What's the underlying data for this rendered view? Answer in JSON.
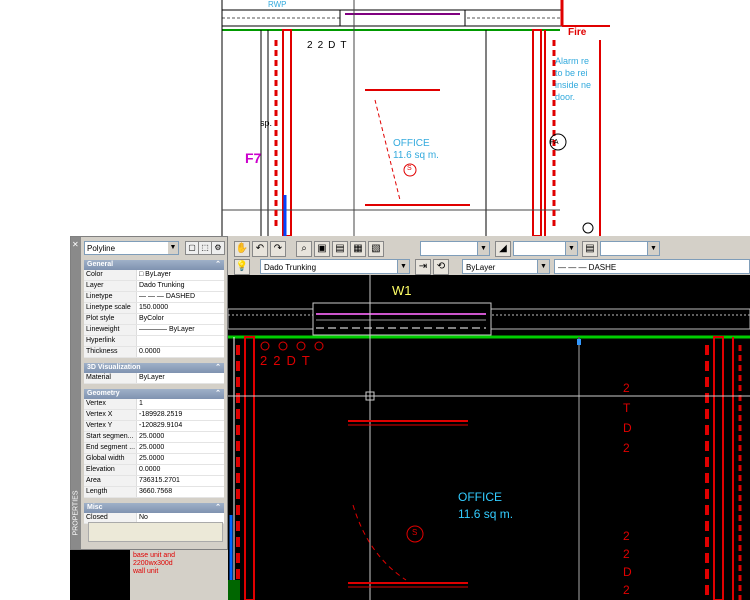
{
  "top_drawing": {
    "rwp_label": "RWP",
    "fire_label": "Fire",
    "alarm_note_lines": [
      "Alarm re",
      "to be rei",
      "inside ne",
      "door."
    ],
    "room_name": "OFFICE",
    "room_area": "11.6 sq m.",
    "socket_symbol": "S",
    "outlet_labels": [
      "2",
      "2",
      "D",
      "T"
    ],
    "grid_label": "F7",
    "fa_symbol": "FA",
    "sp_label": "sp."
  },
  "toolbar": {
    "layer_combo": "Dado Trunking",
    "color_combo": "ByLayer",
    "linetype_combo": "— — — DASHE"
  },
  "properties": {
    "selection": "Polyline",
    "side_title": "PROPERTIES",
    "sections": [
      {
        "title": "General",
        "rows": [
          {
            "label": "Color",
            "value": "□ ByLayer"
          },
          {
            "label": "Layer",
            "value": "Dado Trunking"
          },
          {
            "label": "Linetype",
            "value": "— — — DASHED"
          },
          {
            "label": "Linetype scale",
            "value": "150.0000"
          },
          {
            "label": "Plot style",
            "value": "ByColor"
          },
          {
            "label": "Lineweight",
            "value": "———— ByLayer"
          },
          {
            "label": "Hyperlink",
            "value": ""
          },
          {
            "label": "Thickness",
            "value": "0.0000"
          }
        ]
      },
      {
        "title": "3D Visualization",
        "rows": [
          {
            "label": "Material",
            "value": "ByLayer"
          }
        ]
      },
      {
        "title": "Geometry",
        "rows": [
          {
            "label": "Vertex",
            "value": "1"
          },
          {
            "label": "Vertex X",
            "value": "-189928.2519"
          },
          {
            "label": "Vertex Y",
            "value": "-120829.9104"
          },
          {
            "label": "Start segmen...",
            "value": "25.0000"
          },
          {
            "label": "End segment ...",
            "value": "25.0000"
          },
          {
            "label": "Global width",
            "value": "25.0000"
          },
          {
            "label": "Elevation",
            "value": "0.0000"
          },
          {
            "label": "Area",
            "value": "736315.2701"
          },
          {
            "label": "Length",
            "value": "3660.7568"
          }
        ]
      },
      {
        "title": "Misc",
        "rows": [
          {
            "label": "Closed",
            "value": "No"
          }
        ]
      }
    ]
  },
  "canvas": {
    "w1_label": "W1",
    "room_name": "OFFICE",
    "room_area": "11.6 sq m.",
    "socket_symbol": "S",
    "outlet_labels": [
      "2",
      "2",
      "D",
      "T"
    ],
    "right_outlets_top": [
      "2",
      "T",
      "D",
      "2"
    ],
    "right_outlets_bottom": [
      "2",
      "2",
      "D",
      "2"
    ],
    "wall_note_lines": [
      "base unit and",
      "2200wx300d",
      "wall unit"
    ],
    "colors": {
      "background": "#000000",
      "wall": "#e00000",
      "text": "#33ccff",
      "w1": "#ffff66"
    }
  }
}
